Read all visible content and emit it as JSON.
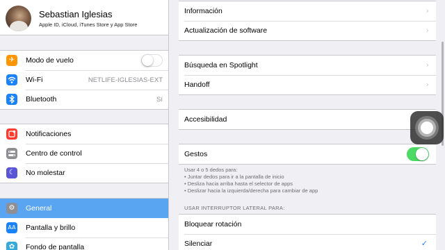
{
  "profile": {
    "name": "Sebastian Iglesias",
    "subtitle": "Apple ID, iCloud, iTunes Store y App Store"
  },
  "sidebar": {
    "group1": [
      {
        "label": "Modo de vuelo",
        "icon": "airplane-icon",
        "color": "#ff9500",
        "glyph": "✈",
        "toggle": false
      },
      {
        "label": "Wi-Fi",
        "icon": "wifi-icon",
        "color": "#1a82fb",
        "glyph": "≋",
        "value": "NETLIFE-IGLESIAS-EXT"
      },
      {
        "label": "Bluetooth",
        "icon": "bluetooth-icon",
        "color": "#1a82fb",
        "glyph": "ᛒ",
        "value": "Sí"
      }
    ],
    "group2": [
      {
        "label": "Notificaciones",
        "icon": "notifications-icon",
        "color": "#ff3b30",
        "glyph": "▣"
      },
      {
        "label": "Centro de control",
        "icon": "control-center-icon",
        "color": "#8e8e93",
        "glyph": "☰"
      },
      {
        "label": "No molestar",
        "icon": "moon-icon",
        "color": "#5856d6",
        "glyph": "☾"
      }
    ],
    "group3": [
      {
        "label": "General",
        "icon": "gear-icon",
        "color": "#8e8e93",
        "glyph": "⚙",
        "selected": true
      },
      {
        "label": "Pantalla y brillo",
        "icon": "display-brightness-icon",
        "color": "#1a82fb",
        "glyph": "AA"
      },
      {
        "label": "Fondo de pantalla",
        "icon": "wallpaper-icon",
        "color": "#34aadc",
        "glyph": "✿"
      }
    ]
  },
  "detail": {
    "group1": [
      "Información",
      "Actualización de software"
    ],
    "group2": [
      "Búsqueda en Spotlight",
      "Handoff"
    ],
    "group3": [
      "Accesibilidad"
    ],
    "gestures_label": "Gestos",
    "gestures_toggle": true,
    "gestures_footer": [
      "Usar 4 o 5 dedos para:",
      "• Juntar dedos para ir a la pantalla de inicio",
      "• Desliza hacia arriba hasta el selector de apps",
      "• Deslizar hacia la izquierda/derecha para cambiar de app"
    ],
    "switch_header": "USAR INTERRUPTOR LATERAL PARA:",
    "switch_options": [
      {
        "label": "Bloquear rotación",
        "checked": false
      },
      {
        "label": "Silenciar",
        "checked": true
      }
    ]
  },
  "colors": {
    "accent": "#1a82fb",
    "selected_row": "#5aa5f2",
    "toggle_on": "#4cd964"
  }
}
